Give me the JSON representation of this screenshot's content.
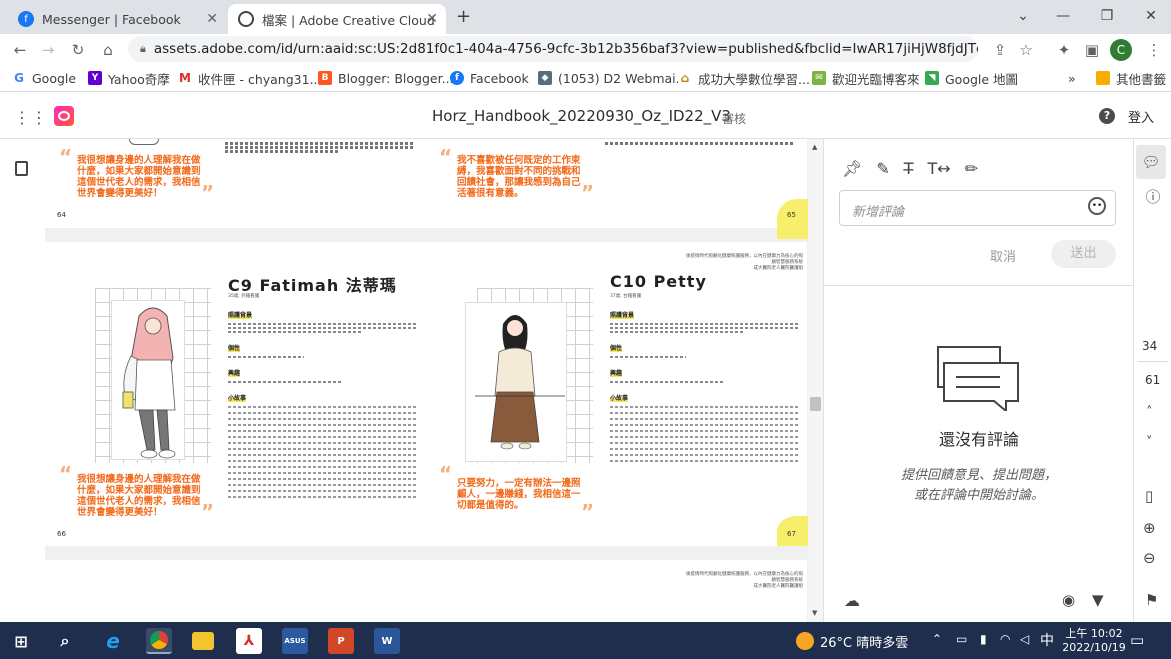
{
  "browser": {
    "tabs": [
      {
        "title": "Messenger | Facebook",
        "active": false
      },
      {
        "title": "檔案 | Adobe Creative Cloud",
        "active": true
      }
    ],
    "new_tab": "+",
    "url": "assets.adobe.com/id/urn:aaid:sc:US:2d81f0c1-404a-4756-9cfc-3b12b356baf3?view=published&fbclid=IwAR17jiHjW8fjdJTdWRuOA2K...",
    "profile_initial": "C",
    "bookmarks": [
      "Google",
      "Yahoo奇摩",
      "收件匣 - chyang31...",
      "Blogger: Blogger...",
      "Facebook",
      "(1053) D2 Webmai...",
      "成功大學數位學習...",
      "歡迎光臨博客來",
      "Google 地圖"
    ],
    "bookmarks_more": "»",
    "other_bookmarks": "其他書籤"
  },
  "app": {
    "doc_title": "Horz_Handbook_20220930_Oz_ID22_V3",
    "review_label": "審核",
    "signin": "登入"
  },
  "document": {
    "top_page": {
      "left_quote": "我很想讓身邊的人理解我在做什麼，如果大家都開始意識到這個世代老人的需求，我相信世界會變得更美好！",
      "right_quote": "我不喜歡被任何既定的工作束縛，我喜歡面對不同的挑戰和回饋社會，那讓我感到為自己活著很有意義。",
      "left_page_num": "64",
      "right_page_num": "65"
    },
    "spread": {
      "header_note": "後疫情時代照顧化健康照護服務，以內在健康力為核心的照顧智慧服務系統",
      "header_note2": "成大醫院老人醫院醫護組",
      "left": {
        "name": "C9 Fatimah 法蒂瑪",
        "meta": "35歲, 外籍看護",
        "sections": [
          "照護背景",
          "個性",
          "興趣",
          "小故事"
        ],
        "quote": "我很想讓身邊的人理解我在做什麼，如果大家都開始意識到這個世代老人的需求，我相信世界會變得更美好！",
        "page_num": "66"
      },
      "right": {
        "name": "C10 Petty",
        "meta": "37歲, 台籍看護",
        "sections": [
          "照護背景",
          "個性",
          "興趣",
          "小故事"
        ],
        "quote": "只要努力，一定有辦法一邊照顧人，一邊賺錢，我相信這一切都是值得的。",
        "page_num": "67"
      }
    },
    "next_header_note": "後疫情時代照顧化健康照護服務，以內在健康力為核心的照顧智慧服務系統",
    "next_header_note2": "成大醫院老人醫院醫護組"
  },
  "comments": {
    "placeholder": "新增評論",
    "cancel": "取消",
    "submit": "送出",
    "empty_title": "還沒有評論",
    "empty_line1": "提供回饋意見、提出問題，",
    "empty_line2": "或在評論中開始討論。"
  },
  "rail": {
    "page_current": "34",
    "page_total": "61"
  },
  "taskbar": {
    "weather": "26°C  晴時多雲",
    "ime": "中",
    "time": "上午 10:02",
    "date": "2022/10/19"
  },
  "colors": {
    "accent_orange": "#f26a1b",
    "highlight_yellow": "#f7ef6b",
    "taskbar": "#1f2e4c"
  }
}
